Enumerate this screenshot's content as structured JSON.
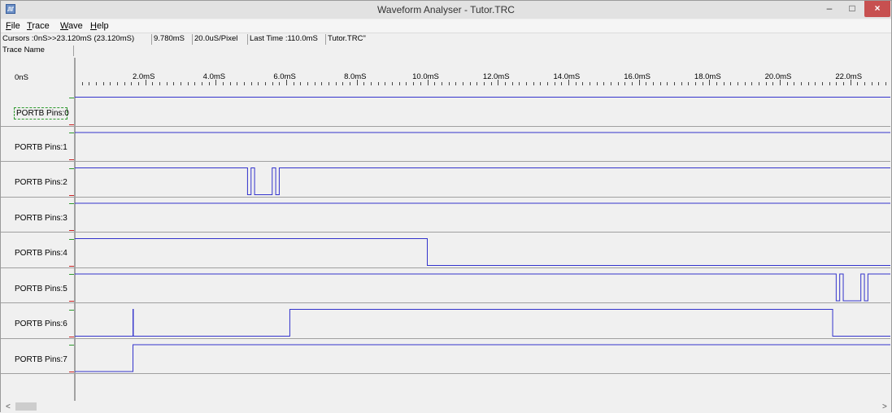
{
  "window": {
    "title": "Waveform Analyser - Tutor.TRC",
    "minimize": "–",
    "maximize": "□",
    "close": "×"
  },
  "menu": [
    {
      "label": "File",
      "u": "F",
      "rest": "ile"
    },
    {
      "label": "Trace",
      "u": "T",
      "rest": "race"
    },
    {
      "label": "Wave",
      "u": "W",
      "rest": "ave"
    },
    {
      "label": "Help",
      "u": "H",
      "rest": "elp"
    }
  ],
  "status": {
    "cursors": "Cursors :0nS>>23.120mS (23.120mS)",
    "delta": "9.780mS",
    "resolution": "20.0uS/Pixel",
    "last_time": "Last Time :110.0mS",
    "file": "Tutor.TRC\""
  },
  "header": {
    "trace_name": "Trace Name",
    "zero": "0nS"
  },
  "ruler": {
    "labels": [
      "2.0mS",
      "4.0mS",
      "6.0mS",
      "8.0mS",
      "10.0mS",
      "12.0mS",
      "14.0mS",
      "16.0mS",
      "18.0mS",
      "20.0mS",
      "22.0mS"
    ],
    "ms_per_label": 2.0,
    "ms_per_minor_tick": 0.2
  },
  "colors": {
    "wave": "#3333cc",
    "high_marker": "#2e9a2e",
    "low_marker": "#cc2222",
    "grid": "#a0a0a0"
  },
  "traces": [
    {
      "name": "PORTB Pins:0",
      "selected": true,
      "edges": [
        {
          "t": 0,
          "level": 1
        }
      ]
    },
    {
      "name": "PORTB Pins:1",
      "selected": false,
      "edges": [
        {
          "t": 0,
          "level": 1
        }
      ]
    },
    {
      "name": "PORTB Pins:2",
      "selected": false,
      "edges": [
        {
          "t": 0,
          "level": 1
        },
        {
          "t": 4.9,
          "level": 0
        },
        {
          "t": 5.0,
          "level": 1
        },
        {
          "t": 5.1,
          "level": 0
        },
        {
          "t": 5.6,
          "level": 1
        },
        {
          "t": 5.7,
          "level": 0
        },
        {
          "t": 5.8,
          "level": 1
        }
      ]
    },
    {
      "name": "PORTB Pins:3",
      "selected": false,
      "edges": [
        {
          "t": 0,
          "level": 1
        }
      ]
    },
    {
      "name": "PORTB Pins:4",
      "selected": false,
      "edges": [
        {
          "t": 0,
          "level": 1
        },
        {
          "t": 10.0,
          "level": 0
        }
      ]
    },
    {
      "name": "PORTB Pins:5",
      "selected": false,
      "edges": [
        {
          "t": 0,
          "level": 1
        },
        {
          "t": 21.6,
          "level": 0
        },
        {
          "t": 21.7,
          "level": 1
        },
        {
          "t": 21.8,
          "level": 0
        },
        {
          "t": 22.3,
          "level": 1
        },
        {
          "t": 22.4,
          "level": 0
        },
        {
          "t": 22.5,
          "level": 1
        }
      ]
    },
    {
      "name": "PORTB Pins:6",
      "selected": false,
      "edges": [
        {
          "t": 0,
          "level": 0
        },
        {
          "t": 1.65,
          "level": 1
        },
        {
          "t": 1.66,
          "level": 0
        },
        {
          "t": 6.1,
          "level": 1
        },
        {
          "t": 21.5,
          "level": 0
        }
      ]
    },
    {
      "name": "PORTB Pins:7",
      "selected": false,
      "edges": [
        {
          "t": 0,
          "level": 0
        },
        {
          "t": 1.65,
          "level": 1
        }
      ]
    }
  ]
}
